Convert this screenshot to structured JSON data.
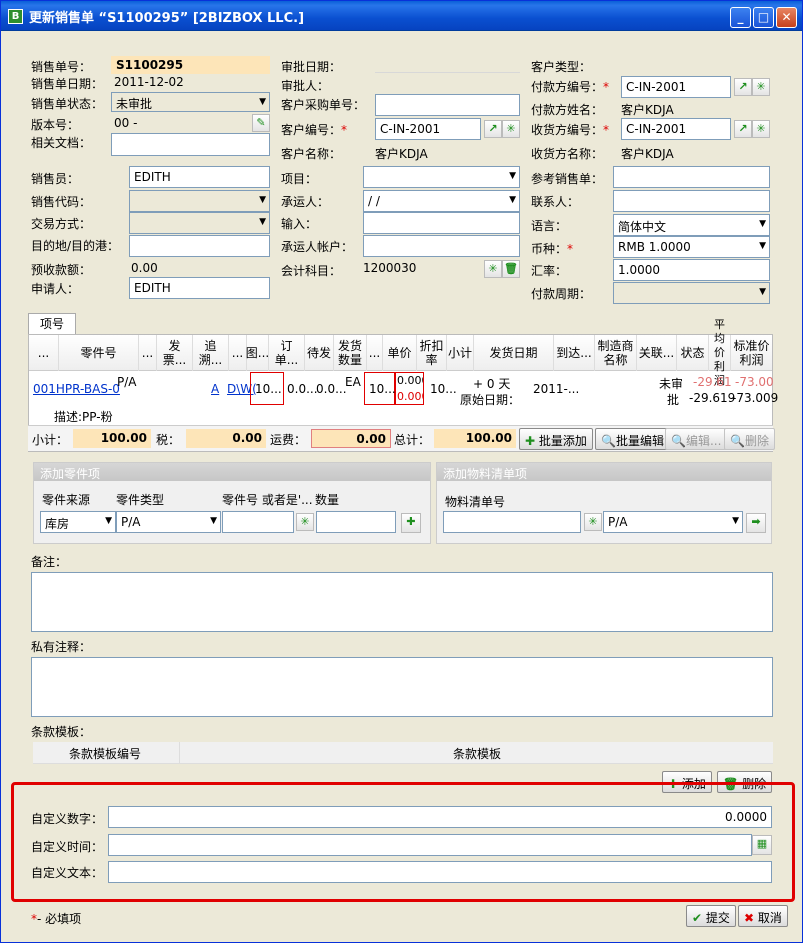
{
  "window": {
    "title": "更新销售单 “S1100295” [2BIZBOX LLC.]",
    "app_icon": "B",
    "min": "_",
    "max": "□",
    "close": "✕"
  },
  "left": {
    "so_no_label": "销售单号：",
    "so_no": "S1100295",
    "so_date_label": "销售单日期：",
    "so_date": "2011-12-02",
    "status_label": "销售单状态：",
    "status": "未审批",
    "version_label": "版本号：",
    "version": "00 -",
    "related_label": "相关文档：",
    "sales_label": "销售员：",
    "sales": "EDITH",
    "sales_code_label": "销售代码：",
    "trade_label": "交易方式：",
    "dest_label": "目的地/目的港：",
    "prepay_label": "预收款额：",
    "prepay": "0.00",
    "applicant_label": "申请人：",
    "applicant": "EDITH"
  },
  "mid": {
    "approve_date_label": "审批日期：",
    "approver_label": "审批人：",
    "cust_po_label": "客户采购单号：",
    "cust_no_label": "客户编号：",
    "cust_no": "C-IN-2001",
    "cust_name_label": "客户名称：",
    "cust_name": "客户KDJA",
    "project_label": "项目：",
    "carrier_label": "承运人：",
    "carrier": "/ /",
    "input_label": "输入：",
    "carrier_acct_label": "承运人帐户：",
    "account_label": "会计科目：",
    "account": "1200030"
  },
  "right": {
    "cust_type_label": "客户类型：",
    "payer_no_label": "付款方编号：",
    "payer_no": "C-IN-2001",
    "payer_name_label": "付款方姓名：",
    "payer_name": "客户KDJA",
    "ship_no_label": "收货方编号：",
    "ship_no": "C-IN-2001",
    "ship_name_label": "收货方名称：",
    "ship_name": "客户KDJA",
    "ref_so_label": "参考销售单：",
    "contact_label": "联系人：",
    "lang_label": "语言：",
    "lang": "简体中文",
    "currency_label": "币种：",
    "currency": "RMB 1.0000",
    "rate_label": "汇率：",
    "rate": "1.0000",
    "period_label": "付款周期："
  },
  "required_star": "*",
  "items": {
    "tab": "项号",
    "headers": [
      "...",
      "零件号",
      "...",
      "发票...",
      "追溯...",
      "...",
      "图...",
      "订单...",
      "待发",
      "发货数量",
      "...",
      "单价",
      "折扣率",
      "小计",
      "发货日期",
      "到达...",
      "制造商名称",
      "关联...",
      "状态",
      "平均价利润",
      "标准价利润"
    ],
    "row": {
      "part_no": "001HPR-BAS-0",
      "pa": "P/A",
      "a": "A",
      "dwg": "D\\W(",
      "order_qty": "10...",
      "pending": "0.0...",
      "ship_qty": "0.0...",
      "unit": "EA",
      "price": "10...",
      "disc1": "0.000",
      "disc2": "0.000",
      "subtotal": "10...",
      "ship_date1": "+ 0 天",
      "ship_date2": "原始日期：",
      "arrive": "2011-...",
      "status1": "未审",
      "status2": "批",
      "avg1": "-29.61",
      "std1": "-73.00",
      "avg2": "-29.619",
      "std2": "-73.009",
      "desc": "描述:PP-粉"
    },
    "subtotal_label": "小计：",
    "subtotal": "100.00",
    "tax_label": "税：",
    "tax": "0.00",
    "freight_label": "运费：",
    "freight": "0.00",
    "total_label": "总计：",
    "total": "100.00",
    "batch_add": "批量添加",
    "batch_edit": "批量编辑",
    "edit": "编辑...",
    "delete": "删除"
  },
  "add_part": {
    "title": "添加零件项",
    "src_label": "零件来源",
    "type_label": "零件类型",
    "pn_label": "零件号 或者是'...",
    "qty_label": "数量",
    "src": "库房",
    "type": "P/A"
  },
  "add_bom": {
    "title": "添加物料清单项",
    "bom_label": "物料清单号",
    "type": "P/A"
  },
  "notes_label": "备注：",
  "private_label": "私有注释：",
  "terms": {
    "label": "条款模板：",
    "col1": "条款模板编号",
    "col2": "条款模板",
    "add": "添加",
    "delete": "删除"
  },
  "custom": {
    "num_label": "自定义数字：",
    "num": "0.0000",
    "time_label": "自定义时间：",
    "text_label": "自定义文本："
  },
  "footer": {
    "required_note": "- 必填项",
    "submit": "提交",
    "cancel": "取消"
  }
}
